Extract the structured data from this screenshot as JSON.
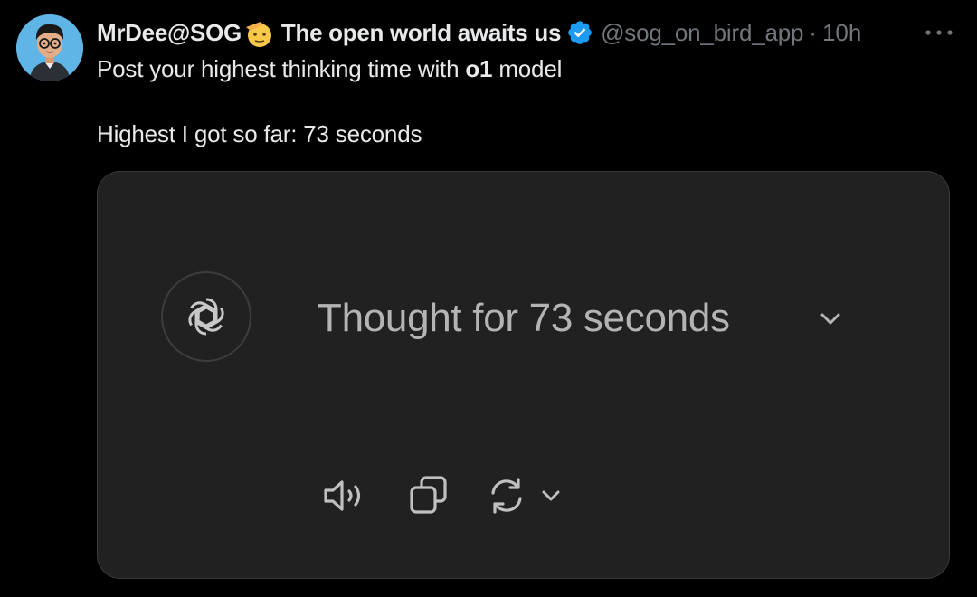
{
  "tweet": {
    "author": {
      "display_name": "MrDee@SOG",
      "display_name_suffix": "The open world awaits us",
      "handle": "@sog_on_bird_app",
      "separator": "·",
      "time": "10h"
    },
    "text": {
      "line1_before": "Post your highest thinking time with ",
      "line1_bold": "o1",
      "line1_after": " model",
      "line2": "Highest I got so far: 73 seconds"
    }
  },
  "media": {
    "thought_label": "Thought for 73 seconds",
    "icons": {
      "logo": "openai-logo-icon",
      "expand": "chevron-down-icon",
      "read_aloud": "speaker-icon",
      "copy": "copy-icon",
      "regenerate": "refresh-icon",
      "regenerate_menu": "chevron-down-icon"
    }
  },
  "colors": {
    "background": "#000000",
    "primary_text": "#e7e9ea",
    "secondary_text": "#71767b",
    "verified_blue": "#1d9bf0",
    "card_background": "#212121",
    "card_text": "#b4b4b4"
  }
}
